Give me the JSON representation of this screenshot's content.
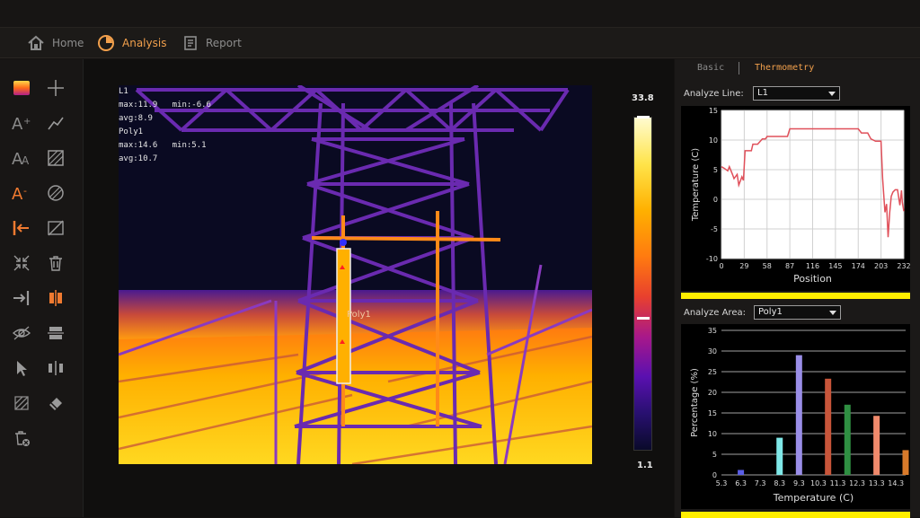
{
  "nav": {
    "items": [
      {
        "label": "Home",
        "icon": "home-icon"
      },
      {
        "label": "Analysis",
        "icon": "analysis-icon",
        "active": true
      },
      {
        "label": "Report",
        "icon": "report-icon"
      }
    ]
  },
  "image": {
    "overlay_stats": [
      "L1",
      "max:11.9   min:-6.6",
      "avg:8.9",
      "Poly1",
      "max:14.6   min:5.1",
      "avg:10.7"
    ],
    "poly_label": "Poly1",
    "scale_max": "33.8",
    "scale_min": "1.1"
  },
  "side": {
    "tabs": [
      {
        "label": "Basic"
      },
      {
        "label": "Thermometry",
        "active": true
      }
    ],
    "analyze_line_label": "Analyze Line:",
    "analyze_line_value": "L1",
    "analyze_area_label": "Analyze Area:",
    "analyze_area_value": "Poly1"
  },
  "colors": {
    "accent": "#f2a04c",
    "highlight_bar": "#ffee00",
    "line_series": "#e0505a"
  },
  "chart_data": [
    {
      "type": "line",
      "xlabel": "Position",
      "ylabel": "Temperature (C)",
      "x_ticks": [
        "0",
        "29",
        "58",
        "87",
        "116",
        "145",
        "174",
        "203",
        "232"
      ],
      "y_ticks": [
        "15",
        "10",
        "5",
        "0",
        "-5",
        "-10"
      ],
      "xlim": [
        0,
        232
      ],
      "ylim": [
        -10,
        15
      ],
      "grid": true,
      "series": [
        {
          "x": [
            0,
            4,
            8,
            10,
            14,
            16,
            20,
            22,
            26,
            28,
            30,
            38,
            40,
            44,
            46,
            52,
            56,
            58,
            62,
            66,
            72,
            78,
            84,
            87,
            100,
            116,
            130,
            145,
            160,
            174,
            178,
            186,
            190,
            196,
            203,
            205,
            208,
            210,
            212,
            214,
            216,
            218,
            221,
            224,
            227,
            229,
            230,
            232
          ],
          "y": [
            5.5,
            5.2,
            4.8,
            5.5,
            4.2,
            3.5,
            4.2,
            2.4,
            3.8,
            3.2,
            8.2,
            8.2,
            9.3,
            9.3,
            9.3,
            10.2,
            10.2,
            10.6,
            10.6,
            10.6,
            10.6,
            10.6,
            10.6,
            11.9,
            11.9,
            11.9,
            11.9,
            11.9,
            11.9,
            11.9,
            11.2,
            11.2,
            10.2,
            9.8,
            9.8,
            3.5,
            -2.2,
            -0.8,
            -6.4,
            -2.2,
            0.5,
            1.2,
            1.6,
            1.6,
            -1.0,
            1.5,
            -0.5,
            -2.0
          ]
        }
      ]
    },
    {
      "type": "bar",
      "xlabel": "Temperature (C)",
      "ylabel": "Percentage (%)",
      "x_ticks": [
        "5.3",
        "6.3",
        "7.3",
        "8.3",
        "9.3",
        "10.3",
        "11.3",
        "12.3",
        "13.3",
        "14.3"
      ],
      "y_ticks": [
        "35",
        "30",
        "25",
        "20",
        "15",
        "10",
        "5",
        "0"
      ],
      "ylim": [
        0,
        35
      ],
      "grid": true,
      "bars": [
        {
          "x": 6.3,
          "value": 1.2,
          "color": "#5a5ee6"
        },
        {
          "x": 8.3,
          "value": 9,
          "color": "#7fe8e8"
        },
        {
          "x": 9.3,
          "value": 29,
          "color": "#9a8ee8"
        },
        {
          "x": 10.8,
          "value": 23.3,
          "color": "#c8553a"
        },
        {
          "x": 11.8,
          "value": 17,
          "color": "#2f8f42"
        },
        {
          "x": 13.3,
          "value": 14.3,
          "color": "#f08a6c"
        },
        {
          "x": 14.8,
          "value": 6,
          "color": "#d87a2a"
        }
      ]
    }
  ]
}
